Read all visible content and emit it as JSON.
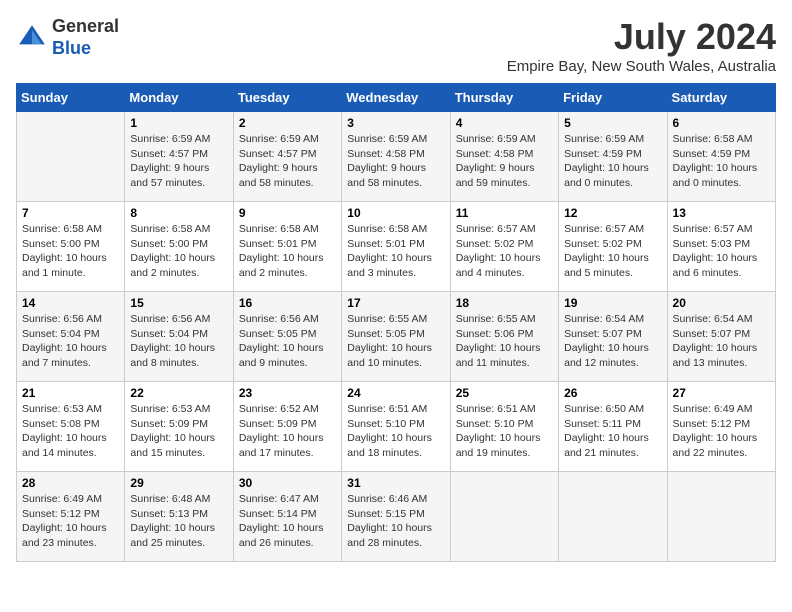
{
  "logo": {
    "general": "General",
    "blue": "Blue"
  },
  "title": "July 2024",
  "location": "Empire Bay, New South Wales, Australia",
  "days_of_week": [
    "Sunday",
    "Monday",
    "Tuesday",
    "Wednesday",
    "Thursday",
    "Friday",
    "Saturday"
  ],
  "weeks": [
    [
      {
        "day": "",
        "info": ""
      },
      {
        "day": "1",
        "info": "Sunrise: 6:59 AM\nSunset: 4:57 PM\nDaylight: 9 hours\nand 57 minutes."
      },
      {
        "day": "2",
        "info": "Sunrise: 6:59 AM\nSunset: 4:57 PM\nDaylight: 9 hours\nand 58 minutes."
      },
      {
        "day": "3",
        "info": "Sunrise: 6:59 AM\nSunset: 4:58 PM\nDaylight: 9 hours\nand 58 minutes."
      },
      {
        "day": "4",
        "info": "Sunrise: 6:59 AM\nSunset: 4:58 PM\nDaylight: 9 hours\nand 59 minutes."
      },
      {
        "day": "5",
        "info": "Sunrise: 6:59 AM\nSunset: 4:59 PM\nDaylight: 10 hours\nand 0 minutes."
      },
      {
        "day": "6",
        "info": "Sunrise: 6:58 AM\nSunset: 4:59 PM\nDaylight: 10 hours\nand 0 minutes."
      }
    ],
    [
      {
        "day": "7",
        "info": "Sunrise: 6:58 AM\nSunset: 5:00 PM\nDaylight: 10 hours\nand 1 minute."
      },
      {
        "day": "8",
        "info": "Sunrise: 6:58 AM\nSunset: 5:00 PM\nDaylight: 10 hours\nand 2 minutes."
      },
      {
        "day": "9",
        "info": "Sunrise: 6:58 AM\nSunset: 5:01 PM\nDaylight: 10 hours\nand 2 minutes."
      },
      {
        "day": "10",
        "info": "Sunrise: 6:58 AM\nSunset: 5:01 PM\nDaylight: 10 hours\nand 3 minutes."
      },
      {
        "day": "11",
        "info": "Sunrise: 6:57 AM\nSunset: 5:02 PM\nDaylight: 10 hours\nand 4 minutes."
      },
      {
        "day": "12",
        "info": "Sunrise: 6:57 AM\nSunset: 5:02 PM\nDaylight: 10 hours\nand 5 minutes."
      },
      {
        "day": "13",
        "info": "Sunrise: 6:57 AM\nSunset: 5:03 PM\nDaylight: 10 hours\nand 6 minutes."
      }
    ],
    [
      {
        "day": "14",
        "info": "Sunrise: 6:56 AM\nSunset: 5:04 PM\nDaylight: 10 hours\nand 7 minutes."
      },
      {
        "day": "15",
        "info": "Sunrise: 6:56 AM\nSunset: 5:04 PM\nDaylight: 10 hours\nand 8 minutes."
      },
      {
        "day": "16",
        "info": "Sunrise: 6:56 AM\nSunset: 5:05 PM\nDaylight: 10 hours\nand 9 minutes."
      },
      {
        "day": "17",
        "info": "Sunrise: 6:55 AM\nSunset: 5:05 PM\nDaylight: 10 hours\nand 10 minutes."
      },
      {
        "day": "18",
        "info": "Sunrise: 6:55 AM\nSunset: 5:06 PM\nDaylight: 10 hours\nand 11 minutes."
      },
      {
        "day": "19",
        "info": "Sunrise: 6:54 AM\nSunset: 5:07 PM\nDaylight: 10 hours\nand 12 minutes."
      },
      {
        "day": "20",
        "info": "Sunrise: 6:54 AM\nSunset: 5:07 PM\nDaylight: 10 hours\nand 13 minutes."
      }
    ],
    [
      {
        "day": "21",
        "info": "Sunrise: 6:53 AM\nSunset: 5:08 PM\nDaylight: 10 hours\nand 14 minutes."
      },
      {
        "day": "22",
        "info": "Sunrise: 6:53 AM\nSunset: 5:09 PM\nDaylight: 10 hours\nand 15 minutes."
      },
      {
        "day": "23",
        "info": "Sunrise: 6:52 AM\nSunset: 5:09 PM\nDaylight: 10 hours\nand 17 minutes."
      },
      {
        "day": "24",
        "info": "Sunrise: 6:51 AM\nSunset: 5:10 PM\nDaylight: 10 hours\nand 18 minutes."
      },
      {
        "day": "25",
        "info": "Sunrise: 6:51 AM\nSunset: 5:10 PM\nDaylight: 10 hours\nand 19 minutes."
      },
      {
        "day": "26",
        "info": "Sunrise: 6:50 AM\nSunset: 5:11 PM\nDaylight: 10 hours\nand 21 minutes."
      },
      {
        "day": "27",
        "info": "Sunrise: 6:49 AM\nSunset: 5:12 PM\nDaylight: 10 hours\nand 22 minutes."
      }
    ],
    [
      {
        "day": "28",
        "info": "Sunrise: 6:49 AM\nSunset: 5:12 PM\nDaylight: 10 hours\nand 23 minutes."
      },
      {
        "day": "29",
        "info": "Sunrise: 6:48 AM\nSunset: 5:13 PM\nDaylight: 10 hours\nand 25 minutes."
      },
      {
        "day": "30",
        "info": "Sunrise: 6:47 AM\nSunset: 5:14 PM\nDaylight: 10 hours\nand 26 minutes."
      },
      {
        "day": "31",
        "info": "Sunrise: 6:46 AM\nSunset: 5:15 PM\nDaylight: 10 hours\nand 28 minutes."
      },
      {
        "day": "",
        "info": ""
      },
      {
        "day": "",
        "info": ""
      },
      {
        "day": "",
        "info": ""
      }
    ]
  ]
}
